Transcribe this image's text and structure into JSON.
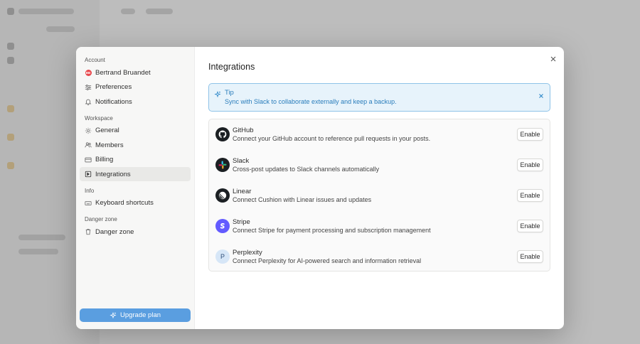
{
  "nav": {
    "sections": [
      {
        "label": "Account",
        "items": [
          {
            "label": "Bertrand Bruandet",
            "icon": "avatar",
            "initials": "BB"
          },
          {
            "label": "Preferences",
            "icon": "sliders-icon"
          },
          {
            "label": "Notifications",
            "icon": "bell-icon"
          }
        ]
      },
      {
        "label": "Workspace",
        "items": [
          {
            "label": "General",
            "icon": "gear-icon"
          },
          {
            "label": "Members",
            "icon": "users-icon"
          },
          {
            "label": "Billing",
            "icon": "credit-card-icon"
          },
          {
            "label": "Integrations",
            "icon": "plus-square-icon",
            "active": true
          }
        ]
      },
      {
        "label": "Info",
        "items": [
          {
            "label": "Keyboard shortcuts",
            "icon": "keyboard-icon"
          }
        ]
      },
      {
        "label": "Danger zone",
        "items": [
          {
            "label": "Danger zone",
            "icon": "trash-icon"
          }
        ]
      }
    ],
    "upgrade_label": "Upgrade plan"
  },
  "main": {
    "title": "Integrations",
    "tip": {
      "title": "Tip",
      "text": "Sync with Slack to collaborate externally and keep a backup."
    },
    "integrations": [
      {
        "name": "GitHub",
        "description": "Connect your GitHub account to reference pull requests in your posts.",
        "button": "Enable",
        "icon": "github-icon"
      },
      {
        "name": "Slack",
        "description": "Cross-post updates to Slack channels automatically",
        "button": "Enable",
        "icon": "slack-icon"
      },
      {
        "name": "Linear",
        "description": "Connect Cushion with Linear issues and updates",
        "button": "Enable",
        "icon": "linear-icon"
      },
      {
        "name": "Stripe",
        "description": "Connect Stripe for payment processing and subscription management",
        "button": "Enable",
        "icon": "stripe-icon"
      },
      {
        "name": "Perplexity",
        "description": "Connect Perplexity for AI-powered search and information retrieval",
        "button": "Enable",
        "icon": "perplexity-icon",
        "letter": "P"
      }
    ]
  },
  "colors": {
    "accent": "#5a9ee0",
    "tip_bg": "#e7f3fb",
    "tip_text": "#2a7dbb",
    "avatar": "#e8474c",
    "stripe": "#635bff"
  }
}
